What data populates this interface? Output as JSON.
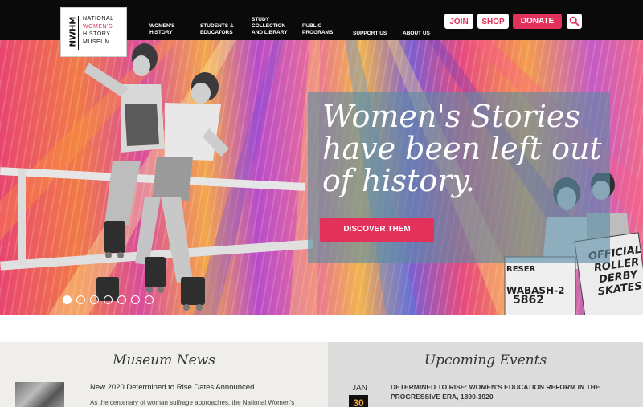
{
  "header": {
    "logo": {
      "mark": "NWHM",
      "lines": [
        "NATIONAL",
        "WOMEN'S",
        "HISTORY",
        "MUSEUM"
      ]
    },
    "nav": [
      {
        "label": "WOMEN'S\nHISTORY"
      },
      {
        "label": "STUDENTS &\nEDUCATORS"
      },
      {
        "label": "STUDY\nCOLLECTION\nAND LIBRARY"
      },
      {
        "label": "PUBLIC\nPROGRAMS"
      },
      {
        "label": "SUPPORT US"
      },
      {
        "label": "ABOUT US"
      }
    ],
    "buttons": {
      "join": "JOIN",
      "shop": "SHOP",
      "donate": "DONATE"
    },
    "search_icon": "search-icon"
  },
  "hero": {
    "headline": "Women's Stories have been left out of history.",
    "cta_label": "DISCOVER THEM",
    "slide_count": 7,
    "active_slide": 1,
    "sign_text": [
      "RESER",
      "WABASH-2",
      "5862",
      "OFFICIAL",
      "ROLLER",
      "DERBY",
      "SKATES"
    ]
  },
  "news": {
    "title": "Museum News",
    "headline": "New 2020 Determined to Rise Dates Announced",
    "excerpt": "As the centenary of woman suffrage approaches, the National Women's"
  },
  "events": {
    "title": "Upcoming Events",
    "month": "JAN",
    "day": "30",
    "event_title": "DETERMINED TO RISE: WOMEN'S EDUCATION REFORM IN THE PROGRESSIVE ERA, 1890-1920"
  },
  "colors": {
    "accent": "#e2315a",
    "header_bg": "#0a0a0a",
    "overlay": "#5a8ca5"
  }
}
